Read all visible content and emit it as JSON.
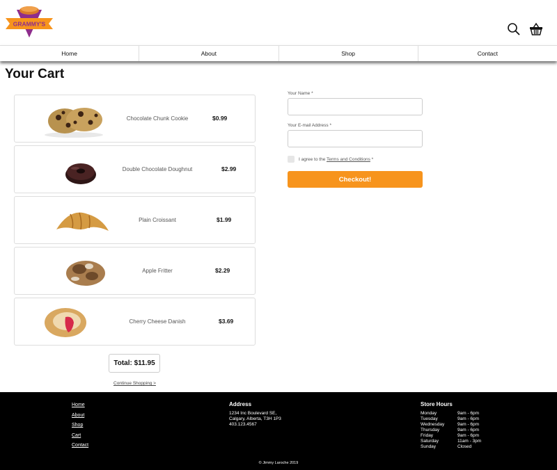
{
  "brand": {
    "logo_text": "GRAMMY'S",
    "accent_color": "#f7941d",
    "logo_purple": "#8e2d8c"
  },
  "header": {
    "icons": [
      "search-icon",
      "basket-icon"
    ]
  },
  "nav": {
    "items": [
      {
        "label": "Home"
      },
      {
        "label": "About"
      },
      {
        "label": "Shop"
      },
      {
        "label": "Contact"
      }
    ]
  },
  "page": {
    "title": "Your Cart"
  },
  "cart": {
    "items": [
      {
        "name": "Chocolate Chunk Cookie",
        "price": "$0.99",
        "image": "cookie"
      },
      {
        "name": "Double Chocolate Doughnut",
        "price": "$2.99",
        "image": "doughnut"
      },
      {
        "name": "Plain Croissant",
        "price": "$1.99",
        "image": "croissant"
      },
      {
        "name": "Apple Fritter",
        "price": "$2.29",
        "image": "fritter"
      },
      {
        "name": "Cherry Cheese Danish",
        "price": "$3.69",
        "image": "danish"
      }
    ],
    "total": "Total: $11.95",
    "continue_label": "Continue Shopping >"
  },
  "form": {
    "name_label": "Your Name *",
    "name_value": "",
    "email_label": "Your E-mail Address *",
    "email_value": "",
    "agree_prefix": "I agree to the ",
    "terms_link": "Terms and Conditions",
    "agree_suffix": " *",
    "checkout_label": "Checkout!"
  },
  "footer": {
    "links": [
      {
        "label": "Home"
      },
      {
        "label": "About"
      },
      {
        "label": "Shop"
      },
      {
        "label": "Cart"
      },
      {
        "label": "Contact"
      }
    ],
    "address": {
      "heading": "Address",
      "lines": [
        "1234 Inc Boulevard SE,",
        "Calgary, Alberta, T3H 1P3",
        "403.123.4567"
      ]
    },
    "hours": {
      "heading": "Store Hours",
      "rows": [
        {
          "day": "Monday",
          "time": "9am - 6pm"
        },
        {
          "day": "Tuesday",
          "time": "9am - 6pm"
        },
        {
          "day": "Wednesday",
          "time": "9am - 6pm"
        },
        {
          "day": "Thursday",
          "time": "9am - 6pm"
        },
        {
          "day": "Friday",
          "time": "9am - 6pm"
        },
        {
          "day": "Saturday",
          "time": "11am - 3pm"
        },
        {
          "day": "Sunday",
          "time": "Closed"
        }
      ]
    },
    "copyright": "© Jimmy Laroche 2019"
  }
}
